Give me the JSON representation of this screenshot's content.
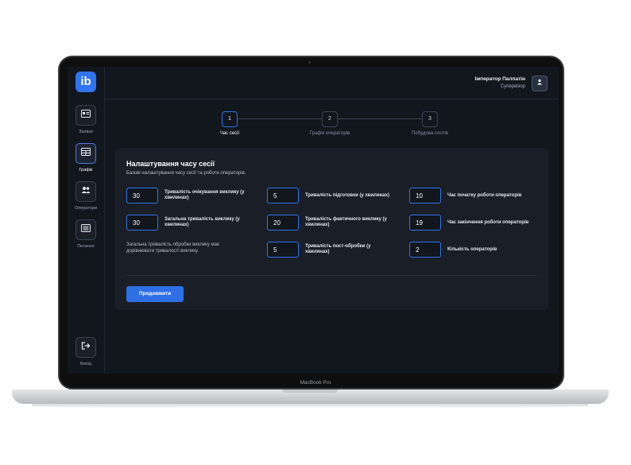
{
  "app": {
    "logo_glyph": "ib"
  },
  "sidebar": {
    "items": [
      {
        "label": "Заявки",
        "icon": "id-card-icon"
      },
      {
        "label": "Графік",
        "icon": "table-icon"
      },
      {
        "label": "Оператори",
        "icon": "users-icon"
      },
      {
        "label": "Питання",
        "icon": "list-icon"
      }
    ],
    "logout": {
      "label": "Вихід",
      "icon": "logout-icon"
    }
  },
  "header": {
    "user_name": "Імператор Палпатін",
    "user_role": "Супервізор",
    "avatar_icon": "user-icon"
  },
  "stepper": {
    "steps": [
      {
        "number": "1",
        "label": "Час сесії"
      },
      {
        "number": "2",
        "label": "Графік операторів"
      },
      {
        "number": "3",
        "label": "Побудова слотів"
      }
    ]
  },
  "form": {
    "title": "Налаштування часу сесії",
    "subtitle": "Базові налаштування часу сесії та роботи операторів.",
    "fields": [
      {
        "value": "30",
        "label_line1": "Тривалість очікування виклику (у",
        "label_line2": "хвилинах)"
      },
      {
        "value": "30",
        "label_line1": "Загальна тривалість виклику (у",
        "label_line2": "хвилинах)"
      },
      {
        "value": "5",
        "label_line1": "Тривалість підготовки (у хвилинах)",
        "label_line2": ""
      },
      {
        "value": "20",
        "label_line1": "Тривалість фактичного виклику (у",
        "label_line2": "хвилинах)"
      },
      {
        "value": "5",
        "label_line1": "Тривалість пост-обробки (у",
        "label_line2": "хвилинах)"
      },
      {
        "value": "10",
        "label_line1": "Час початку роботи операторів",
        "label_line2": ""
      },
      {
        "value": "19",
        "label_line1": "Час закінчення роботи операторів",
        "label_line2": ""
      },
      {
        "value": "2",
        "label_line1": "Кількість операторів",
        "label_line2": ""
      }
    ],
    "note_line1": "Загальна тривалість обробки виклику має",
    "note_line2": "дорівнювати тривалості виклику.",
    "continue_label": "Продовжити"
  },
  "device": {
    "label": "MacBook Pro"
  }
}
